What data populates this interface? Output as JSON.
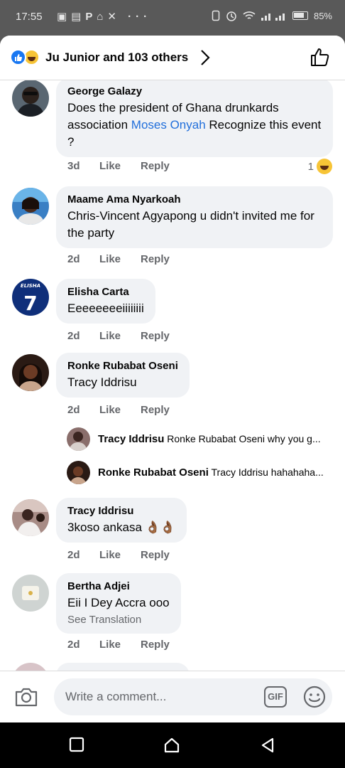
{
  "status_bar": {
    "time": "17:55",
    "left_icons": "▣▤P⌂✕ ···",
    "battery_percent": "85%",
    "battery_level": 0.85
  },
  "header": {
    "reactions": [
      "like-icon",
      "haha-icon"
    ],
    "title": "Ju Junior and 103 others"
  },
  "comments": [
    {
      "author": "George Galazy",
      "text_parts": [
        "Does the president of Ghana drunkards association ",
        "Moses Onyah",
        " Recognize this event ?"
      ],
      "time": "3d",
      "like_label": "Like",
      "reply_label": "Reply",
      "reaction_count": "1"
    },
    {
      "author": "Maame Ama Nyarkoah",
      "text": "Chris-Vincent Agyapong u didn't invited me for the party",
      "time": "2d",
      "like_label": "Like",
      "reply_label": "Reply"
    },
    {
      "author": "Elisha Carta",
      "text": "Eeeeeeeeiiiiiiii",
      "time": "2d",
      "like_label": "Like",
      "reply_label": "Reply",
      "avatar_text": "ELISHA"
    },
    {
      "author": "Ronke Rubabat Oseni",
      "mention": "Tracy Iddrisu",
      "time": "2d",
      "like_label": "Like",
      "reply_label": "Reply",
      "replies": [
        {
          "author": "Tracy Iddrisu",
          "text": "Ronke Rubabat Oseni why you g..."
        },
        {
          "author": "Ronke Rubabat Oseni",
          "text": "Tracy Iddrisu hahahaha..."
        }
      ]
    },
    {
      "author": "Tracy Iddrisu",
      "text": "3koso ankasa 👌🏾👌🏾",
      "time": "2d",
      "like_label": "Like",
      "reply_label": "Reply"
    },
    {
      "author": "Bertha Adjei",
      "text": "Eii I Dey Accra ooo",
      "see_translation": "See Translation",
      "time": "2d",
      "like_label": "Like",
      "reply_label": "Reply"
    }
  ],
  "composer": {
    "placeholder": "Write a comment...",
    "gif_label": "GIF"
  },
  "colors": {
    "brand_blue": "#1877f2",
    "mention_blue": "#216fdb",
    "bubble_bg": "#f0f2f5",
    "meta_gray": "#65676b"
  }
}
